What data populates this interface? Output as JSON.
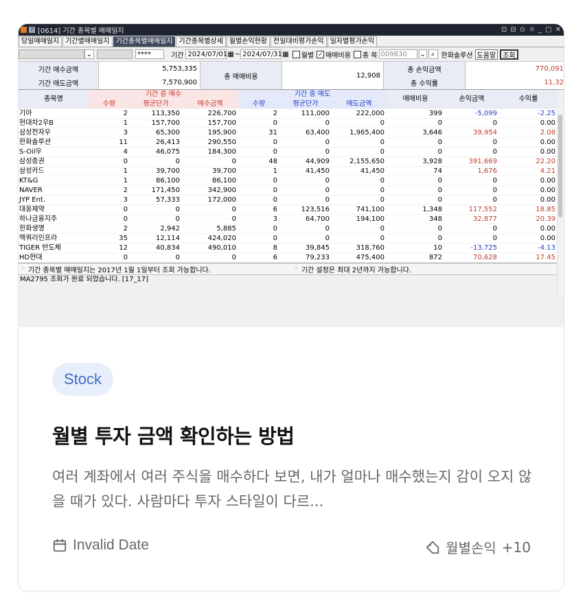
{
  "window": {
    "title": "[0614] 기간 종목별 매매일지",
    "controls": [
      "⊡",
      "⊟",
      "⊙",
      "☼",
      "_",
      "□",
      "✕"
    ]
  },
  "tabs": [
    {
      "label": "당일매매일지",
      "active": false
    },
    {
      "label": "기간별매매일지",
      "active": false
    },
    {
      "label": "기간종목별매매일지",
      "active": true
    },
    {
      "label": "기간종목별상세",
      "active": false
    },
    {
      "label": "월별손익현황",
      "active": false
    },
    {
      "label": "전일대비평가손익",
      "active": false
    },
    {
      "label": "일자별평가손익",
      "active": false
    }
  ],
  "toolbar": {
    "password": "****",
    "period_label": "기간",
    "start_date": "2024/07/01",
    "tilde": "~",
    "end_date": "2024/07/31",
    "monthly_label": "월별",
    "fee_label": "매매비용",
    "stock_label": "종 목",
    "stock_code": "009830",
    "stock_name": "한화솔루션",
    "help_label": "도움말",
    "query_label": "조회"
  },
  "summary": {
    "buy_total_label": "기간 매수금액",
    "buy_total_value": "5,753,335",
    "sell_total_label": "기간 매도금액",
    "sell_total_value": "7,570,900",
    "fee_label": "총 매매비용",
    "fee_value": "12,908",
    "pnl_label": "총 손익금액",
    "pnl_value": "770,091",
    "return_label": "총 수익률",
    "return_value": "11.32"
  },
  "table": {
    "name_header": "종목명",
    "buy_group": "기간 중 매수",
    "sell_group": "기간 중 매도",
    "fee_header": "매매비용",
    "pnl_header": "손익금액",
    "ret_header": "수익률",
    "sub_headers": [
      "수량",
      "평균단가",
      "매수금액",
      "수량",
      "평균단가",
      "매도금액"
    ],
    "rows": [
      [
        "기아",
        "2",
        "113,350",
        "226,700",
        "2",
        "111,000",
        "222,000",
        "399",
        "-5,099",
        "-2.25"
      ],
      [
        "현대차2우B",
        "1",
        "157,700",
        "157,700",
        "0",
        "0",
        "0",
        "0",
        "0",
        "0.00"
      ],
      [
        "삼성전자우",
        "3",
        "65,300",
        "195,900",
        "31",
        "63,400",
        "1,965,400",
        "3,646",
        "39,954",
        "2.08"
      ],
      [
        "한화솔루션",
        "11",
        "26,413",
        "290,550",
        "0",
        "0",
        "0",
        "0",
        "0",
        "0.00"
      ],
      [
        "S-Oil우",
        "4",
        "46,075",
        "184,300",
        "0",
        "0",
        "0",
        "0",
        "0",
        "0.00"
      ],
      [
        "삼성증권",
        "0",
        "0",
        "0",
        "48",
        "44,909",
        "2,155,650",
        "3,928",
        "391,669",
        "22.20"
      ],
      [
        "삼성카드",
        "1",
        "39,700",
        "39,700",
        "1",
        "41,450",
        "41,450",
        "74",
        "1,676",
        "4.21"
      ],
      [
        "KT&G",
        "1",
        "86,100",
        "86,100",
        "0",
        "0",
        "0",
        "0",
        "0",
        "0.00"
      ],
      [
        "NAVER",
        "2",
        "171,450",
        "342,900",
        "0",
        "0",
        "0",
        "0",
        "0",
        "0.00"
      ],
      [
        "JYP Ent.",
        "3",
        "57,333",
        "172,000",
        "0",
        "0",
        "0",
        "0",
        "0",
        "0.00"
      ],
      [
        "대웅제약",
        "0",
        "0",
        "0",
        "6",
        "123,516",
        "741,100",
        "1,348",
        "117,552",
        "18.85"
      ],
      [
        "하나금융지주",
        "0",
        "0",
        "0",
        "3",
        "64,700",
        "194,100",
        "348",
        "32,877",
        "20.39"
      ],
      [
        "한화생명",
        "2",
        "2,942",
        "5,885",
        "0",
        "0",
        "0",
        "0",
        "0",
        "0.00"
      ],
      [
        "맥쿼리인프라",
        "35",
        "12,114",
        "424,020",
        "0",
        "0",
        "0",
        "0",
        "0",
        "0.00"
      ],
      [
        "TIGER 반도체",
        "12",
        "40,834",
        "490,010",
        "8",
        "39,845",
        "318,760",
        "10",
        "-13,725",
        "-4.13"
      ],
      [
        "HD현대",
        "0",
        "0",
        "0",
        "6",
        "79,233",
        "475,400",
        "872",
        "70,628",
        "17.45"
      ]
    ]
  },
  "notes": {
    "note1": "기간 종목별 매매일지는 2017년 1월 1일부터 조회 가능합니다.",
    "note2": "기간 설정은 최대 2년까지 가능합니다."
  },
  "status_text": "MA2795 조회가 완료 되었습니다. [17_17]",
  "card": {
    "category": "Stock",
    "title": "월별 투자 금액 확인하는 방법",
    "excerpt": "여러 계좌에서 여러 주식을 매수하다 보면, 내가 얼마나 매수했는지 감이 오지 않을 때가 있다. 사람마다 투자 스타일이 다르...",
    "date": "Invalid Date",
    "tag": "월별손익",
    "tag_more": "+10",
    "date_icon": "calendar-icon",
    "tag_icon": "tag-icon"
  },
  "colors": {
    "badge_bg": "#e8effb",
    "badge_text": "#3f6ac7",
    "gain": "#c0392b",
    "loss": "#1f3cc0",
    "titlebar": "#1f2430"
  }
}
